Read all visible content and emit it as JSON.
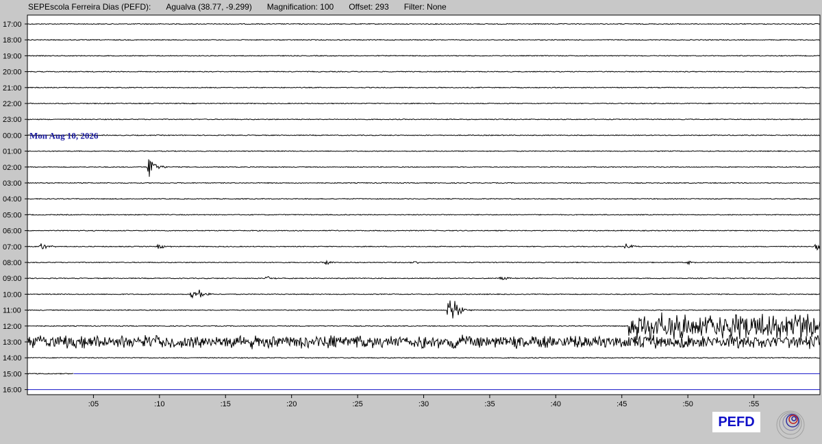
{
  "header": {
    "station": "SEPEscola Ferreira Dias (PEFD):",
    "location": "Agualva (38.77, -9.299)",
    "magnification": "Magnification: 100",
    "offset": "Offset: 293",
    "filter": "Filter: None"
  },
  "logo": {
    "text": "PEFD"
  },
  "colors": {
    "background": "#c8c8c8",
    "plot": "#ffffff",
    "trace": "#000000",
    "future": "#1010c8",
    "date": "#1a1aa0"
  },
  "chart_data": {
    "type": "line",
    "title": "",
    "xlabel": "",
    "ylabel": "",
    "xlim": [
      0,
      60
    ],
    "x_ticks": [
      ":05",
      ":10",
      ":15",
      ":20",
      ":25",
      ":30",
      ":35",
      ":40",
      ":45",
      ":50",
      ":55"
    ],
    "x_tick_values": [
      5,
      10,
      15,
      20,
      25,
      30,
      35,
      40,
      45,
      50,
      55
    ],
    "rows": [
      "17:00",
      "18:00",
      "19:00",
      "20:00",
      "21:00",
      "22:00",
      "23:00",
      "00:00",
      "01:00",
      "02:00",
      "03:00",
      "04:00",
      "05:00",
      "06:00",
      "07:00",
      "08:00",
      "09:00",
      "10:00",
      "11:00",
      "12:00",
      "13:00",
      "14:00",
      "15:00",
      "16:00"
    ],
    "date_annotation": {
      "text": "Mon Aug 10, 2026",
      "row": "00:00"
    },
    "events": [
      {
        "row": "02:00",
        "minute": 9.2,
        "amplitude": 1.0
      },
      {
        "row": "07:00",
        "minute": 1.0,
        "amplitude": 0.3
      },
      {
        "row": "07:00",
        "minute": 9.9,
        "amplitude": 0.25
      },
      {
        "row": "07:00",
        "minute": 45.3,
        "amplitude": 0.25
      },
      {
        "row": "07:00",
        "minute": 59.7,
        "amplitude": 0.3
      },
      {
        "row": "08:00",
        "minute": 22.6,
        "amplitude": 0.2
      },
      {
        "row": "08:00",
        "minute": 29.1,
        "amplitude": 0.2
      },
      {
        "row": "08:00",
        "minute": 50.0,
        "amplitude": 0.2
      },
      {
        "row": "09:00",
        "minute": 18.1,
        "amplitude": 0.2
      },
      {
        "row": "09:00",
        "minute": 35.8,
        "amplitude": 0.2
      },
      {
        "row": "10:00",
        "minute": 12.4,
        "amplitude": 0.35
      },
      {
        "row": "10:00",
        "minute": 13.0,
        "amplitude": 0.35
      },
      {
        "row": "11:00",
        "minute": 31.9,
        "amplitude": 2.0
      }
    ],
    "noise_bursts": [
      {
        "row": "12:00",
        "start": 45.5,
        "end": 60,
        "amplitude": 1.2
      },
      {
        "row": "13:00",
        "start": 0,
        "end": 60,
        "amplitude": 0.6
      }
    ],
    "data_end": {
      "row": "15:00",
      "minute": 3.5
    }
  }
}
